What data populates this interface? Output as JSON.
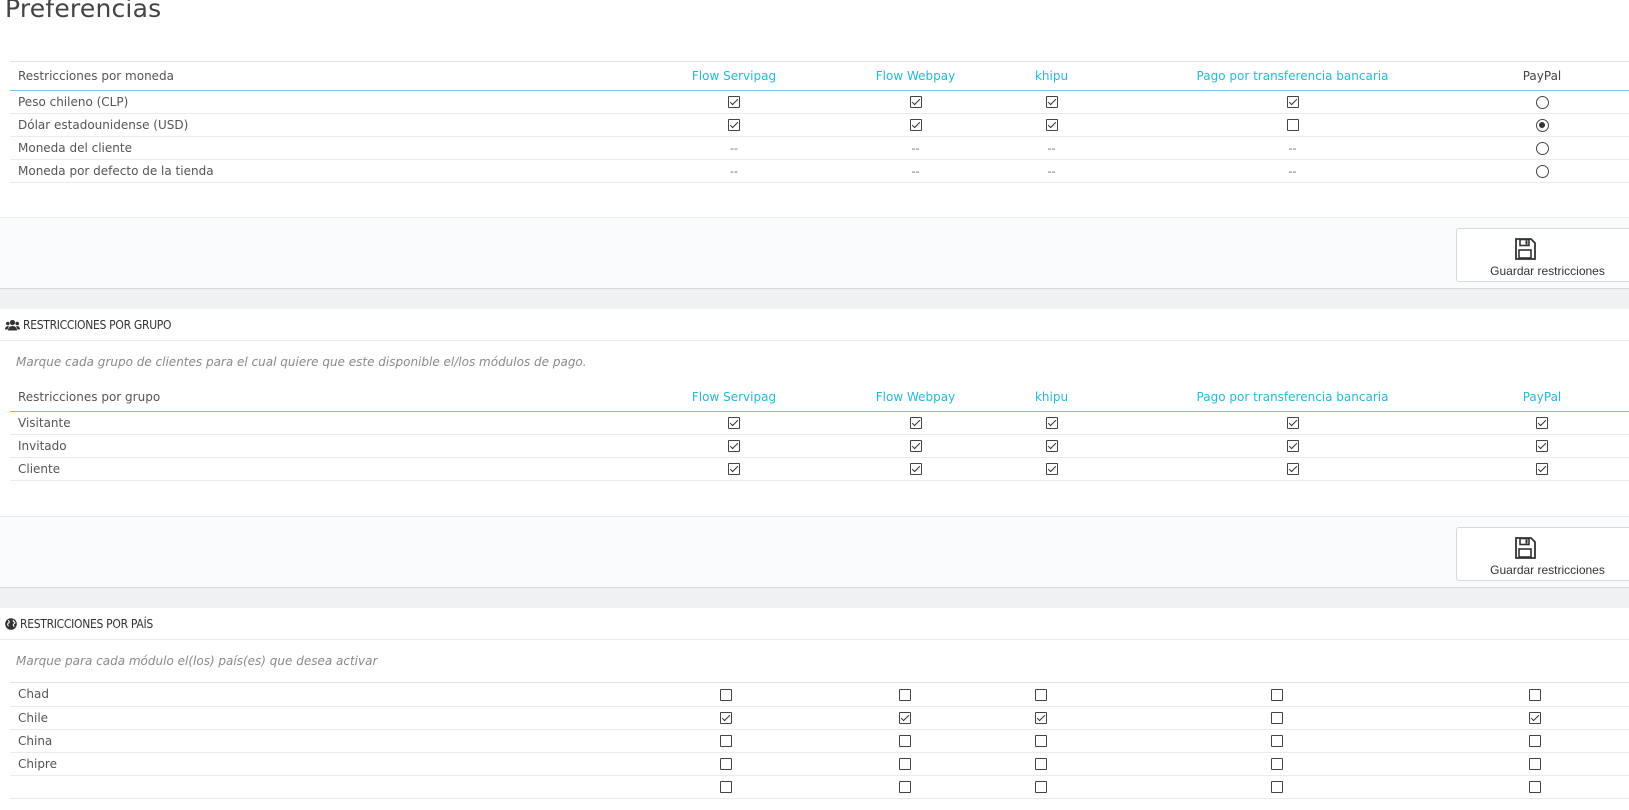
{
  "page": {
    "title": "Preferencias"
  },
  "columns": [
    "Flow Servipag",
    "Flow Webpay",
    "khipu",
    "Pago por transferencia bancaria",
    "PayPal"
  ],
  "currency": {
    "header_label": "Restricciones por moneda",
    "rows": [
      {
        "label": "Peso chileno (CLP)",
        "cells": [
          "check-on",
          "check-on",
          "check-on",
          "check-on",
          "radio-off"
        ]
      },
      {
        "label": "Dólar estadounidense (USD)",
        "cells": [
          "check-on",
          "check-on",
          "check-on",
          "check-off",
          "radio-on"
        ]
      },
      {
        "label": "Moneda del cliente",
        "cells": [
          "--",
          "--",
          "--",
          "--",
          "radio-off"
        ]
      },
      {
        "label": "Moneda por defecto de la tienda",
        "cells": [
          "--",
          "--",
          "--",
          "--",
          "radio-off"
        ]
      }
    ],
    "save_label": "Guardar restricciones"
  },
  "group": {
    "section_title": "Restricciones por grupo",
    "description": "Marque cada grupo de clientes para el cual quiere que este disponible el/los módulos de pago.",
    "header_label": "Restricciones por grupo",
    "rows": [
      {
        "label": "Visitante",
        "cells": [
          "check-on",
          "check-on",
          "check-on",
          "check-on",
          "check-on"
        ]
      },
      {
        "label": "Invitado",
        "cells": [
          "check-on",
          "check-on",
          "check-on",
          "check-on",
          "check-on"
        ]
      },
      {
        "label": "Cliente",
        "cells": [
          "check-on",
          "check-on",
          "check-on",
          "check-on",
          "check-on"
        ]
      }
    ],
    "save_label": "Guardar restricciones"
  },
  "country": {
    "section_title": "Restricciones por país",
    "description": "Marque para cada módulo el(los) país(es) que desea activar",
    "rows": [
      {
        "label": "Chad",
        "cells": [
          "check-off",
          "check-off",
          "check-off",
          "check-off",
          "check-off"
        ]
      },
      {
        "label": "Chile",
        "cells": [
          "check-on",
          "check-on",
          "check-on",
          "check-off",
          "check-on"
        ]
      },
      {
        "label": "China",
        "cells": [
          "check-off",
          "check-off",
          "check-off",
          "check-off",
          "check-off"
        ]
      },
      {
        "label": "Chipre",
        "cells": [
          "check-off",
          "check-off",
          "check-off",
          "check-off",
          "check-off"
        ]
      },
      {
        "label": "",
        "cells": [
          "check-off",
          "check-off",
          "check-off",
          "check-off",
          "check-off"
        ]
      }
    ]
  },
  "colors": {
    "accent": "#25b9d7",
    "panel_bg": "#fafbfc",
    "gap_bg": "#eff1f2"
  },
  "icons": {
    "save": "floppy-disk-icon",
    "group": "users-icon",
    "country": "globe-icon"
  }
}
